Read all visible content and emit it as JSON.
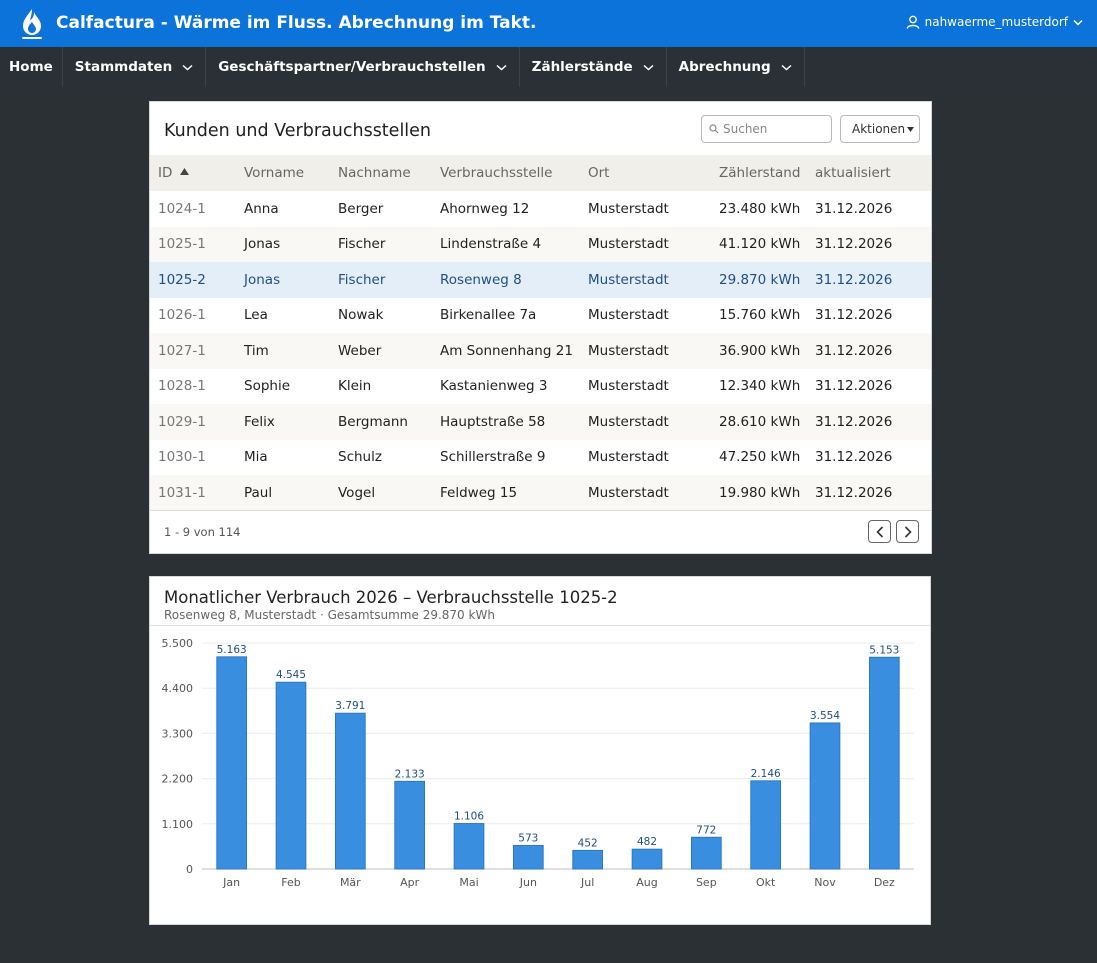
{
  "app": {
    "title": "Calfactura - Wärme im Fluss. Abrechnung im Takt.",
    "username": "nahwaerme_musterdorf",
    "brand_color": "#0b73d9",
    "nav_color": "#2a3035"
  },
  "nav": {
    "items": [
      {
        "label": "Home",
        "has_dropdown": false
      },
      {
        "label": "Stammdaten",
        "has_dropdown": true
      },
      {
        "label": "Geschäftspartner/Verbrauchstellen",
        "has_dropdown": true
      },
      {
        "label": "Zählerstände",
        "has_dropdown": true
      },
      {
        "label": "Abrechnung",
        "has_dropdown": true
      }
    ]
  },
  "table_panel": {
    "title": "Kunden und Verbrauchsstellen",
    "search_placeholder": "Suchen",
    "actions_label": "Aktionen",
    "sort_column": "ID",
    "sort_direction": "ascending",
    "columns": [
      "ID",
      "Vorname",
      "Nachname",
      "Verbrauchsstelle",
      "Ort",
      "Zählerstand",
      "aktualisiert"
    ],
    "rows": [
      {
        "id": "1024-1",
        "vorname": "Anna",
        "nachname": "Berger",
        "verbrauchsstelle": "Ahornweg 12",
        "ort": "Musterstadt",
        "zaehlerstand": "23.480 kWh",
        "aktualisiert": "31.12.2026"
      },
      {
        "id": "1025-1",
        "vorname": "Jonas",
        "nachname": "Fischer",
        "verbrauchsstelle": "Lindenstraße 4",
        "ort": "Musterstadt",
        "zaehlerstand": "41.120 kWh",
        "aktualisiert": "31.12.2026"
      },
      {
        "id": "1025-2",
        "vorname": "Jonas",
        "nachname": "Fischer",
        "verbrauchsstelle": "Rosenweg 8",
        "ort": "Musterstadt",
        "zaehlerstand": "29.870 kWh",
        "aktualisiert": "31.12.2026",
        "selected": true
      },
      {
        "id": "1026-1",
        "vorname": "Lea",
        "nachname": "Nowak",
        "verbrauchsstelle": "Birkenallee 7a",
        "ort": "Musterstadt",
        "zaehlerstand": "15.760 kWh",
        "aktualisiert": "31.12.2026"
      },
      {
        "id": "1027-1",
        "vorname": "Tim",
        "nachname": "Weber",
        "verbrauchsstelle": "Am Sonnenhang 21",
        "ort": "Musterstadt",
        "zaehlerstand": "36.900 kWh",
        "aktualisiert": "31.12.2026"
      },
      {
        "id": "1028-1",
        "vorname": "Sophie",
        "nachname": "Klein",
        "verbrauchsstelle": "Kastanienweg 3",
        "ort": "Musterstadt",
        "zaehlerstand": "12.340 kWh",
        "aktualisiert": "31.12.2026"
      },
      {
        "id": "1029-1",
        "vorname": "Felix",
        "nachname": "Bergmann",
        "verbrauchsstelle": "Hauptstraße 58",
        "ort": "Musterstadt",
        "zaehlerstand": "28.610 kWh",
        "aktualisiert": "31.12.2026"
      },
      {
        "id": "1030-1",
        "vorname": "Mia",
        "nachname": "Schulz",
        "verbrauchsstelle": "Schillerstraße 9",
        "ort": "Musterstadt",
        "zaehlerstand": "47.250 kWh",
        "aktualisiert": "31.12.2026"
      },
      {
        "id": "1031-1",
        "vorname": "Paul",
        "nachname": "Vogel",
        "verbrauchsstelle": "Feldweg 15",
        "ort": "Musterstadt",
        "zaehlerstand": "19.980 kWh",
        "aktualisiert": "31.12.2026"
      }
    ],
    "pagination_text": "1 - 9 von 114"
  },
  "chart_panel": {
    "title": "Monatlicher Verbrauch 2026 – Verbrauchsstelle 1025-2",
    "subtitle": "Rosenweg 8, Musterstadt · Gesamtsumme 29.870 kWh"
  },
  "chart_data": {
    "type": "bar",
    "title": "Monatlicher Verbrauch 2026 – Verbrauchsstelle 1025-2",
    "subtitle": "Rosenweg 8, Musterstadt · Gesamtsumme 29.870 kWh",
    "xlabel": "",
    "ylabel": "",
    "categories": [
      "Jan",
      "Feb",
      "Mär",
      "Apr",
      "Mai",
      "Jun",
      "Jul",
      "Aug",
      "Sep",
      "Okt",
      "Nov",
      "Dez"
    ],
    "values": [
      5163,
      4545,
      3791,
      2133,
      1106,
      573,
      452,
      482,
      772,
      2146,
      3554,
      5153
    ],
    "value_labels": [
      "5.163",
      "4.545",
      "3.791",
      "2.133",
      "1.106",
      "573",
      "452",
      "482",
      "772",
      "2.146",
      "3.554",
      "5.153"
    ],
    "ylim": [
      0,
      5500
    ],
    "yticks": [
      0,
      1100,
      2200,
      3300,
      4400,
      5500
    ],
    "ytick_labels": [
      "0",
      "1.100",
      "2.200",
      "3.300",
      "4.400",
      "5.500"
    ],
    "grid": true,
    "legend": "none",
    "bar_color": "#3a8ee0"
  }
}
